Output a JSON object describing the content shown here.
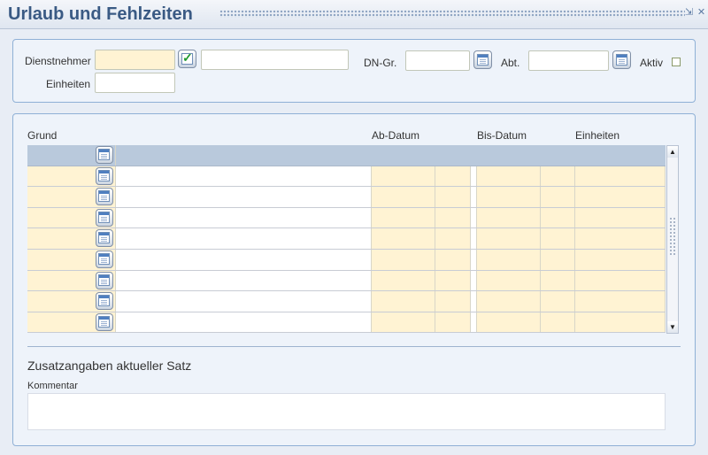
{
  "window": {
    "title": "Urlaub und Fehlzeiten",
    "controls": [
      "restore-icon",
      "close-icon"
    ]
  },
  "header_panel": {
    "dienstnehmer_label": "Dienstnehmer",
    "dienstnehmer_value": "",
    "dienstnehmer_name": "",
    "einheiten_label": "Einheiten",
    "einheiten_value": "",
    "dngr_label": "DN-Gr.",
    "dngr_value": "",
    "abt_label": "Abt.",
    "abt_value": "",
    "aktiv_label": "Aktiv",
    "aktiv_checked": false
  },
  "grid": {
    "columns": [
      "Grund",
      "Ab-Datum",
      "Bis-Datum",
      "Einheiten"
    ],
    "rows": [
      {
        "grund": "",
        "bezeichnung": "",
        "ab_datum": "",
        "ab_zeit": "",
        "bis_datum": "",
        "bis_zeit": "",
        "einheiten": ""
      },
      {
        "grund": "",
        "bezeichnung": "",
        "ab_datum": "",
        "ab_zeit": "",
        "bis_datum": "",
        "bis_zeit": "",
        "einheiten": ""
      },
      {
        "grund": "",
        "bezeichnung": "",
        "ab_datum": "",
        "ab_zeit": "",
        "bis_datum": "",
        "bis_zeit": "",
        "einheiten": ""
      },
      {
        "grund": "",
        "bezeichnung": "",
        "ab_datum": "",
        "ab_zeit": "",
        "bis_datum": "",
        "bis_zeit": "",
        "einheiten": ""
      },
      {
        "grund": "",
        "bezeichnung": "",
        "ab_datum": "",
        "ab_zeit": "",
        "bis_datum": "",
        "bis_zeit": "",
        "einheiten": ""
      },
      {
        "grund": "",
        "bezeichnung": "",
        "ab_datum": "",
        "ab_zeit": "",
        "bis_datum": "",
        "bis_zeit": "",
        "einheiten": ""
      },
      {
        "grund": "",
        "bezeichnung": "",
        "ab_datum": "",
        "ab_zeit": "",
        "bis_datum": "",
        "bis_zeit": "",
        "einheiten": ""
      },
      {
        "grund": "",
        "bezeichnung": "",
        "ab_datum": "",
        "ab_zeit": "",
        "bis_datum": "",
        "bis_zeit": "",
        "einheiten": ""
      },
      {
        "grund": "",
        "bezeichnung": "",
        "ab_datum": "",
        "ab_zeit": "",
        "bis_datum": "",
        "bis_zeit": "",
        "einheiten": ""
      }
    ]
  },
  "details": {
    "section_title": "Zusatzangaben aktueller Satz",
    "kommentar_label": "Kommentar",
    "kommentar_value": ""
  },
  "colors": {
    "title": "#3a5a84",
    "panel_border": "#8fb0d6",
    "required_field": "#fff3d3",
    "selected_row": "#b9c9dc"
  }
}
